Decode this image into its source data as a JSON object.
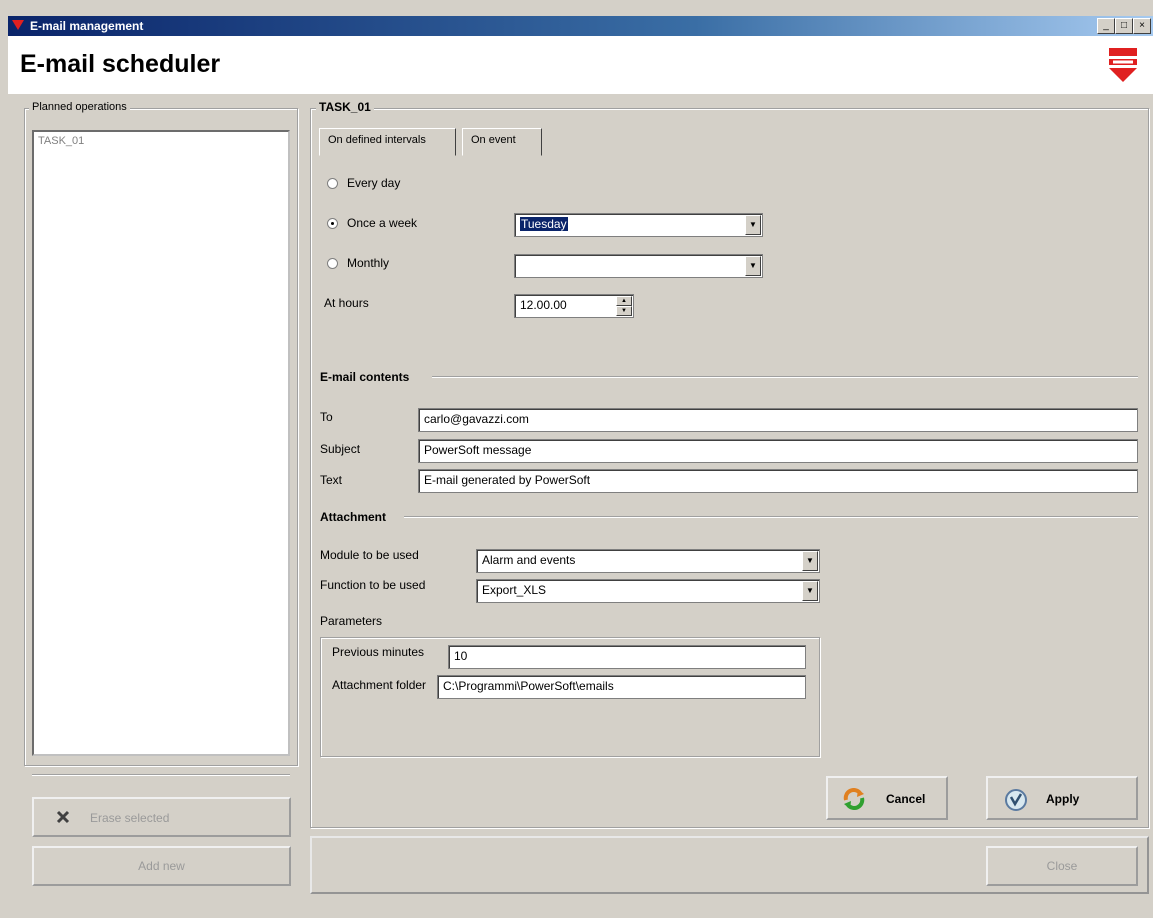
{
  "window": {
    "title": "E-mail management",
    "controls": [
      "_",
      "□",
      "×"
    ]
  },
  "header": {
    "title": "E-mail scheduler"
  },
  "planned": {
    "legend": "Planned operations",
    "items": [
      "TASK_01"
    ],
    "erase_label": "Erase selected",
    "add_label": "Add new"
  },
  "task": {
    "legend": "TASK_01",
    "tabs": [
      "On defined intervals",
      "On event"
    ],
    "schedule": {
      "every_day": "Every day",
      "once_week": "Once a week",
      "weekday_value": "Tuesday",
      "monthly": "Monthly",
      "monthly_value": "",
      "at_hours": "At hours",
      "hours_value": "12.00.00",
      "selected": "once_week"
    },
    "email": {
      "heading": "E-mail contents",
      "to_label": "To",
      "to_value": "carlo@gavazzi.com",
      "subject_label": "Subject",
      "subject_value": "PowerSoft message",
      "text_label": "Text",
      "text_value": "E-mail generated by PowerSoft"
    },
    "attachment": {
      "heading": "Attachment",
      "module_label": "Module to be used",
      "module_value": "Alarm and events",
      "function_label": "Function to be used",
      "function_value": "Export_XLS",
      "parameters_label": "Parameters",
      "prev_minutes_label": "Previous minutes",
      "prev_minutes_value": "10",
      "folder_label": "Attachment folder",
      "folder_value": "C:\\Programmi\\PowerSoft\\emails"
    },
    "cancel_label": "Cancel",
    "apply_label": "Apply"
  },
  "footer": {
    "close_label": "Close"
  },
  "colors": {
    "title_bar": "#0a246a",
    "brand_red": "#e02020",
    "face": "#d4d0c8"
  }
}
